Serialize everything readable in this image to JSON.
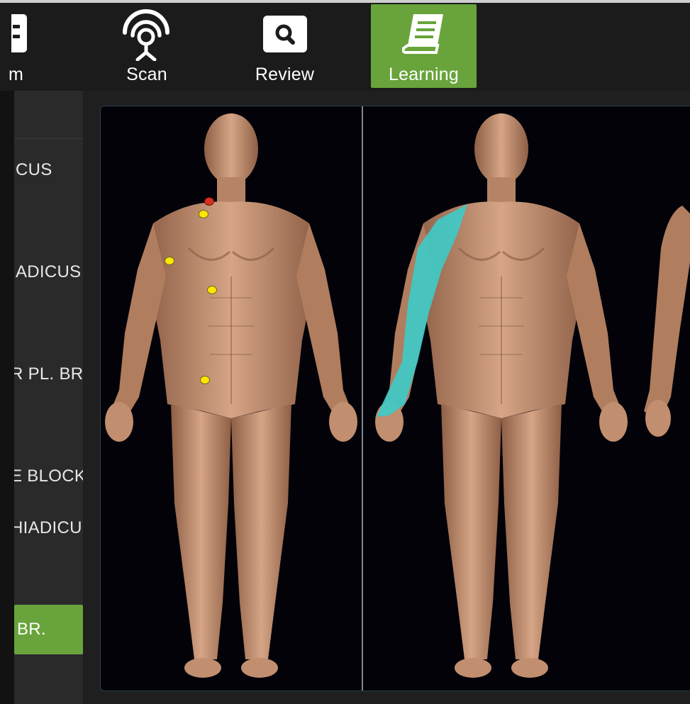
{
  "nav": {
    "items": [
      {
        "label": "m",
        "icon": "exam-icon"
      },
      {
        "label": "Scan",
        "icon": "scan-probe-icon"
      },
      {
        "label": "Review",
        "icon": "search-icon"
      },
      {
        "label": "Learning",
        "icon": "book-icon"
      }
    ],
    "active_color": "#68a43b"
  },
  "sidebar": {
    "items": [
      {
        "label": "ICUS"
      },
      {
        "label": "IADICUS"
      },
      {
        "label": "R PL. BR"
      },
      {
        "label": "E BLOCK"
      },
      {
        "label": "HIADICU"
      },
      {
        "label": "BR.",
        "selected": true
      }
    ]
  },
  "viewer": {
    "markers": [
      {
        "color": "#d7301f"
      },
      {
        "color": "#ffe600"
      },
      {
        "color": "#ffe600"
      },
      {
        "color": "#ffe600"
      },
      {
        "color": "#ffe600"
      }
    ],
    "highlight_color": "#3ecbc8"
  }
}
